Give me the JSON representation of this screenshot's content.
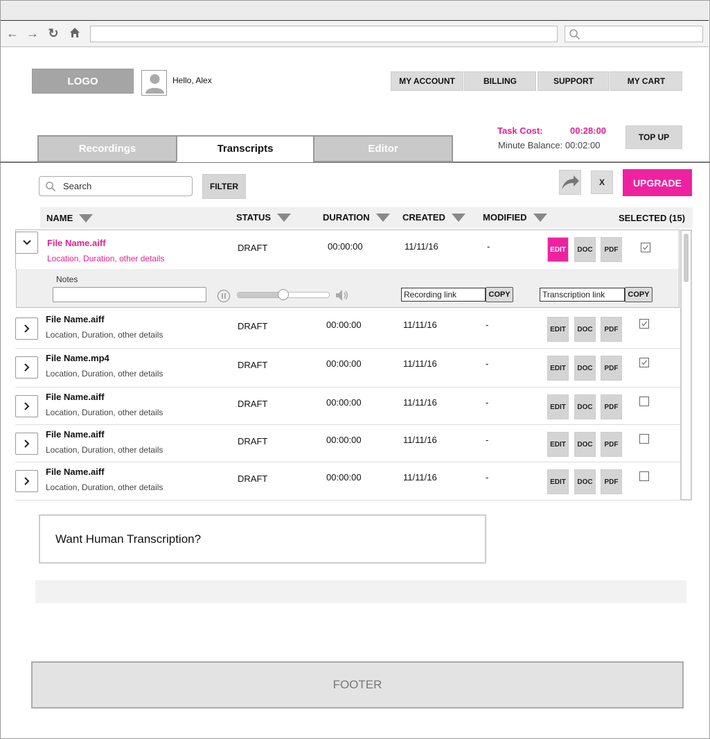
{
  "browser": {
    "url": "",
    "search_placeholder": ""
  },
  "header": {
    "logo": "LOGO",
    "greeting": "Hello, Alex",
    "nav": [
      "MY ACCOUNT",
      "BILLING",
      "SUPPORT",
      "MY CART"
    ],
    "task_cost_label": "Task Cost:",
    "task_cost_value": "00:28:00",
    "minute_balance": "Minute Balance: 00:02:00",
    "top_up": "TOP UP"
  },
  "tabs": [
    {
      "label": "Recordings",
      "active": false
    },
    {
      "label": "Transcripts",
      "active": true
    },
    {
      "label": "Editor",
      "active": false
    }
  ],
  "toolbar": {
    "search_placeholder": "Search",
    "filter": "FILTER",
    "close": "X",
    "upgrade": "UPGRADE"
  },
  "table": {
    "columns": {
      "name": "NAME",
      "status": "STATUS",
      "duration": "DURATION",
      "created": "CREATED",
      "modified": "MODIFIED",
      "selected": "SELECTED (15)"
    },
    "actions": {
      "edit": "EDIT",
      "doc": "DOC",
      "pdf": "PDF"
    },
    "rows": [
      {
        "name": "File Name.aiff",
        "details": "Location, Duration, other details",
        "status": "DRAFT",
        "duration": "00:00:00",
        "created": "11/11/16",
        "modified": "-",
        "checked": true,
        "expanded": true
      },
      {
        "name": "File Name.aiff",
        "details": "Location, Duration, other details",
        "status": "DRAFT",
        "duration": "00:00:00",
        "created": "11/11/16",
        "modified": "-",
        "checked": true,
        "expanded": false
      },
      {
        "name": "File Name.mp4",
        "details": "Location, Duration, other details",
        "status": "DRAFT",
        "duration": "00:00:00",
        "created": "11/11/16",
        "modified": "-",
        "checked": true,
        "expanded": false
      },
      {
        "name": "File Name.aiff",
        "details": "Location, Duration, other details",
        "status": "DRAFT",
        "duration": "00:00:00",
        "created": "11/11/16",
        "modified": "-",
        "checked": false,
        "expanded": false
      },
      {
        "name": "File Name.aiff",
        "details": "Location, Duration, other details",
        "status": "DRAFT",
        "duration": "00:00:00",
        "created": "11/11/16",
        "modified": "-",
        "checked": false,
        "expanded": false
      },
      {
        "name": "File Name.aiff",
        "details": "Location, Duration, other details",
        "status": "DRAFT",
        "duration": "00:00:00",
        "created": "11/11/16",
        "modified": "-",
        "checked": false,
        "expanded": false
      }
    ],
    "expanded_panel": {
      "notes_label": "Notes",
      "notes_value": "",
      "playback_progress": 0.5,
      "recording_link": "Recording link",
      "transcription_link": "Transcription link",
      "copy": "COPY"
    }
  },
  "promo": "Want Human Transcription?",
  "footer": "FOOTER",
  "colors": {
    "accent": "#ee22a0",
    "button_gray": "#d4d4d4",
    "tab_inactive": "#c9c9c9"
  },
  "icons": [
    "back-icon",
    "forward-icon",
    "reload-icon",
    "home-icon",
    "search-icon",
    "user-avatar-icon",
    "share-icon",
    "chevron-down-icon",
    "chevron-right-icon",
    "pause-icon",
    "speaker-icon",
    "checkbox-icon"
  ]
}
